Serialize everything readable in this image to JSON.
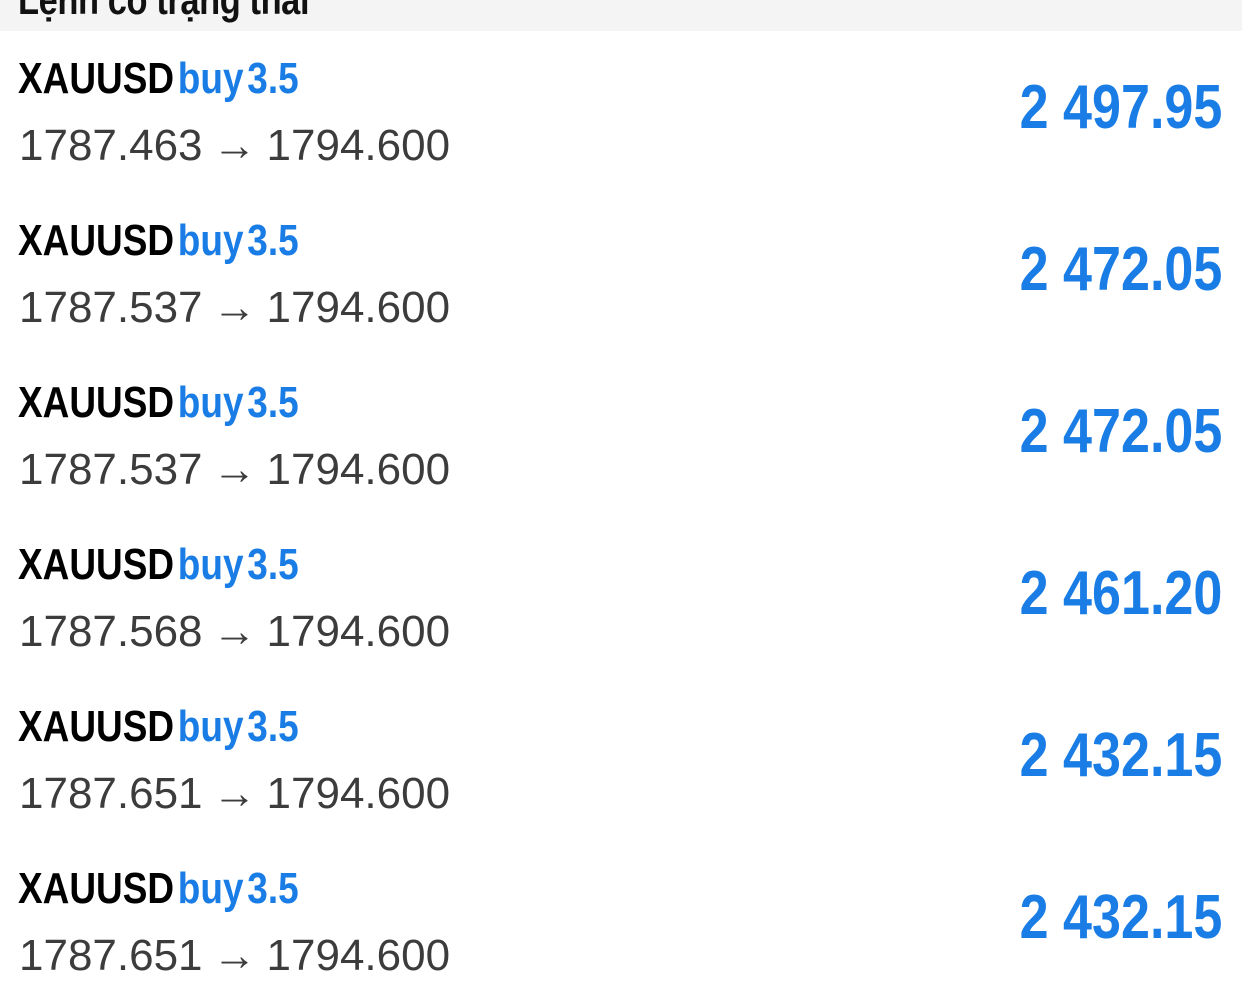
{
  "header": {
    "title": "Lệnh có trạng thái"
  },
  "positions": [
    {
      "symbol": "XAUUSD",
      "type": "buy",
      "volume": "3.5",
      "open_price": "1787.463",
      "arrow": "→",
      "current_price": "1794.600",
      "profit": "2 497.95"
    },
    {
      "symbol": "XAUUSD",
      "type": "buy",
      "volume": "3.5",
      "open_price": "1787.537",
      "arrow": "→",
      "current_price": "1794.600",
      "profit": "2 472.05"
    },
    {
      "symbol": "XAUUSD",
      "type": "buy",
      "volume": "3.5",
      "open_price": "1787.537",
      "arrow": "→",
      "current_price": "1794.600",
      "profit": "2 472.05"
    },
    {
      "symbol": "XAUUSD",
      "type": "buy",
      "volume": "3.5",
      "open_price": "1787.568",
      "arrow": "→",
      "current_price": "1794.600",
      "profit": "2 461.20"
    },
    {
      "symbol": "XAUUSD",
      "type": "buy",
      "volume": "3.5",
      "open_price": "1787.651",
      "arrow": "→",
      "current_price": "1794.600",
      "profit": "2 432.15"
    },
    {
      "symbol": "XAUUSD",
      "type": "buy",
      "volume": "3.5",
      "open_price": "1787.651",
      "arrow": "→",
      "current_price": "1794.600",
      "profit": "2 432.15"
    }
  ],
  "colors": {
    "accent_blue": "#1a7de6",
    "symbol_text": "#000000",
    "price_text": "#3c3c3c",
    "header_bg": "#f4f4f4"
  }
}
